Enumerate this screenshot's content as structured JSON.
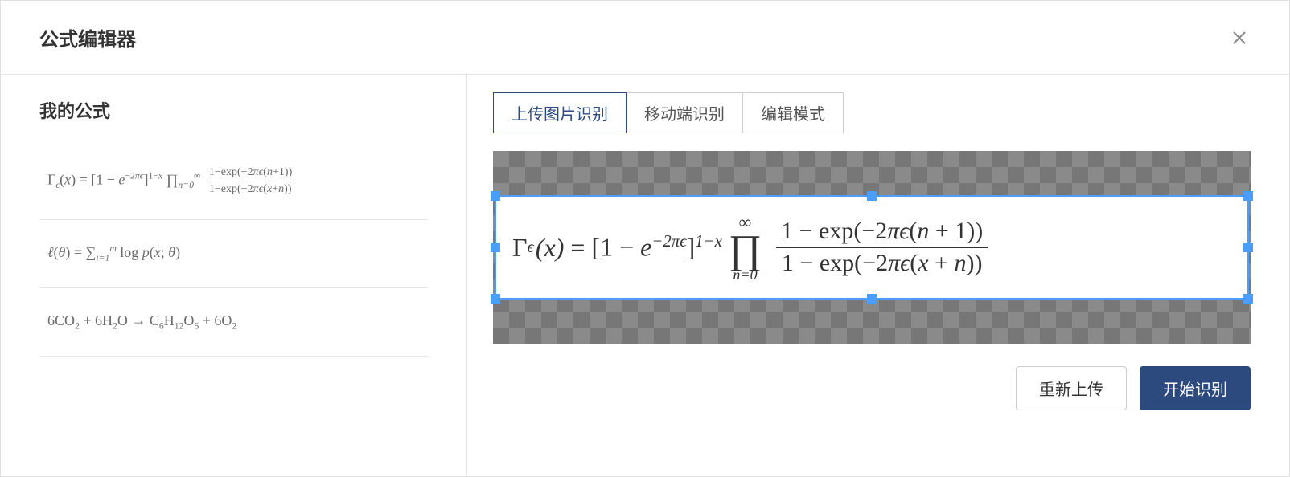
{
  "header": {
    "title": "公式编辑器"
  },
  "left": {
    "heading": "我的公式",
    "formulas": [
      {
        "display_html": "Γ<sub class='it'>ϵ</sub>(<span class='it'>x</span>) = [1 − <span class='it'>e</span><sup>−2<span class='it'>πϵ</span></sup>]<sup>1−<span class='it'>x</span></sup> ∏<sub class='it'>n=0</sub><sup>∞</sup> <span class='sm-frac'><span class='sm-frac-top'>1−exp(−2<span class='it'>πϵ</span>(<span class='it'>n</span>+1))</span><span class='sm-frac-bot'>1−exp(−2<span class='it'>πϵ</span>(<span class='it'>x</span>+<span class='it'>n</span>))</span></span>",
        "latex": "\\Gamma_{\\epsilon}(x)=\\left[1-e^{-2\\pi\\epsilon}\\right]^{1-x}\\prod_{n=0}^{\\infty}\\frac{1-\\exp(-2\\pi\\epsilon(n+1))}{1-\\exp(-2\\pi\\epsilon(x+n))}"
      },
      {
        "display_html": "<span class='it'>ℓ</span>(<span class='it'>θ</span>) = ∑<sub class='it'>i=1</sub><sup class='it'>m</sup> log <span class='it'>p</span>(<span class='it'>x</span>; <span class='it'>θ</span>)",
        "latex": "\\ell(\\theta)=\\sum_{i=1}^{m}\\log p(x;\\theta)"
      },
      {
        "display_html": "6CO<sub>2</sub> + 6H<sub>2</sub>O → C<sub>6</sub>H<sub>12</sub>O<sub>6</sub> + 6O<sub>2</sub>",
        "latex": "6CO_{2}+6H_{2}O\\to C_{6}H_{12}O_{6}+6O_{2}"
      }
    ]
  },
  "right": {
    "tabs": [
      {
        "label": "上传图片识别",
        "active": true
      },
      {
        "label": "移动端识别",
        "active": false
      },
      {
        "label": "编辑模式",
        "active": false
      }
    ],
    "preview_formula": {
      "prefix": "Γ",
      "sub": "ϵ",
      "arg_open": "(x) = [1 − e",
      "exp1": "−2πϵ",
      "mid": "]",
      "exp2": "1−x",
      "prod_top": "∞",
      "prod_sym": "∏",
      "prod_bot": "n=0",
      "frac_top": "1 − exp(−2πϵ(n + 1))",
      "frac_bot": "1 − exp(−2πϵ(x + n))"
    },
    "actions": {
      "reupload": "重新上传",
      "recognize": "开始识别"
    }
  }
}
